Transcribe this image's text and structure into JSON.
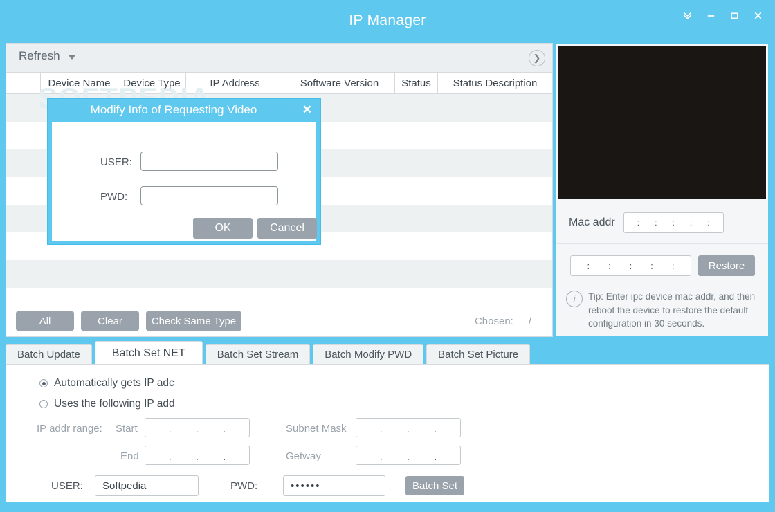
{
  "window": {
    "title": "IP Manager",
    "controls": [
      {
        "name": "collapse-icon",
        "label": "»"
      },
      {
        "name": "minimize-icon",
        "label": "–"
      },
      {
        "name": "maximize-icon",
        "label": "□"
      },
      {
        "name": "close-icon",
        "label": "✕"
      }
    ],
    "accent_color": "#5ec8ef",
    "button_color": "#9aa2ab"
  },
  "toolbar": {
    "refresh_label": "Refresh",
    "dropdown_icon": "chevron-down-icon",
    "expand_icon": "chevron-right-circle-icon"
  },
  "watermark": "SOFTPEDIA",
  "table": {
    "columns": [
      "",
      "Device Name",
      "Device Type",
      "IP Address",
      "Software Version",
      "Status",
      "Status Description"
    ],
    "rows": []
  },
  "selection_bar": {
    "all_label": "All",
    "clear_label": "Clear",
    "check_same_type_label": "Check Same Type",
    "chosen_label": "Chosen:",
    "chosen_separator": "/"
  },
  "right_panel": {
    "video_preview": "video-preview-black",
    "mac_label": "Mac addr",
    "mac_separators": [
      ":",
      ":",
      ":",
      ":",
      ":"
    ],
    "restore_mac_separators": [
      ":",
      ":",
      ":",
      ":",
      ":"
    ],
    "restore_label": "Restore",
    "tip_icon": "info-icon",
    "tip_text": "Tip: Enter ipc device mac addr, and then reboot the device to restore the default configuration in 30 seconds."
  },
  "tabs": [
    {
      "label": "Batch Update",
      "active": false
    },
    {
      "label": "Batch Set NET",
      "active": true
    },
    {
      "label": "Batch Set Stream",
      "active": false
    },
    {
      "label": "Batch Modify PWD",
      "active": false
    },
    {
      "label": "Batch Set Picture",
      "active": false
    }
  ],
  "batch_set_net": {
    "radio_auto_label": "Automatically gets IP adc",
    "radio_auto_selected": true,
    "radio_static_label": "Uses the following IP add",
    "radio_static_selected": false,
    "ip_range_label": "IP addr range:",
    "start_label": "Start",
    "end_label": "End",
    "subnet_mask_label": "Subnet Mask",
    "getway_label": "Getway",
    "ip_dots": [
      ".",
      ".",
      "."
    ],
    "user_label": "USER:",
    "user_value": "Softpedia",
    "pwd_label": "PWD:",
    "pwd_value": "••••••",
    "batch_set_label": "Batch Set"
  },
  "dialog": {
    "title": "Modify Info of Requesting Video",
    "close_icon": "close-icon",
    "user_label": "USER:",
    "user_value": "",
    "pwd_label": "PWD:",
    "pwd_value": "",
    "ok_label": "OK",
    "cancel_label": "Cancel"
  }
}
